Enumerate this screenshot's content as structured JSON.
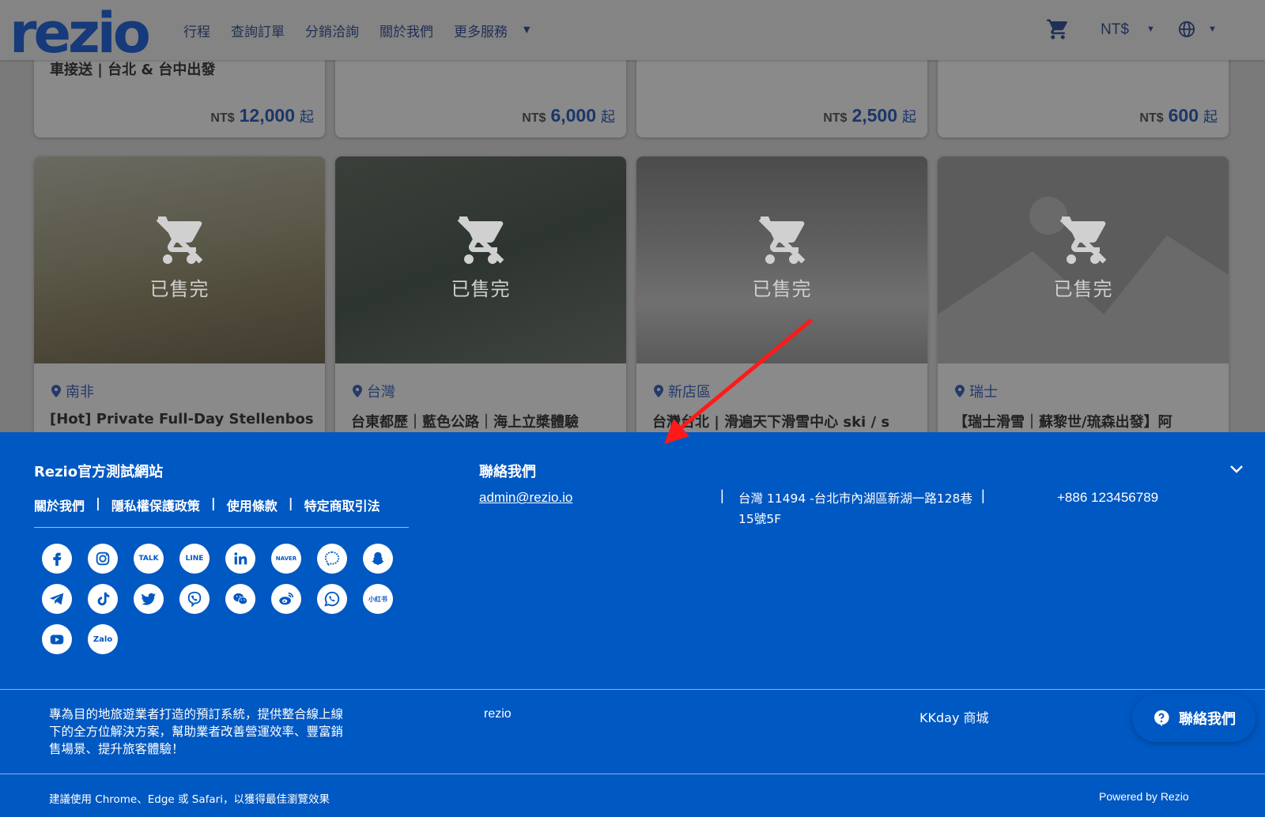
{
  "header": {
    "logo": "rezio",
    "nav": [
      "行程",
      "查詢訂單",
      "分銷洽詢",
      "關於我們",
      "更多服務"
    ],
    "currency": "NT$"
  },
  "top_cards": [
    {
      "title": "車接送 | 台北 & 台中出發",
      "currency": "NT$",
      "price": "12,000",
      "suffix": "起"
    },
    {
      "title": "",
      "currency": "NT$",
      "price": "6,000",
      "suffix": "起"
    },
    {
      "title": "",
      "currency": "NT$",
      "price": "2,500",
      "suffix": "起"
    },
    {
      "title": "",
      "currency": "NT$",
      "price": "600",
      "suffix": "起"
    }
  ],
  "products": [
    {
      "status": "已售完",
      "location": "南非",
      "title": "[Hot] Private Full-Day Stellenbos"
    },
    {
      "status": "已售完",
      "location": "台灣",
      "title": "台東都歷｜藍色公路｜海上立槳體驗"
    },
    {
      "status": "已售完",
      "location": "新店區",
      "title": "台灣台北 | 滑遍天下滑雪中心 ski / s"
    },
    {
      "status": "已售完",
      "location": "瑞士",
      "title": "【瑞士滑雪｜蘇黎世/琉森出發】阿"
    }
  ],
  "footer": {
    "site_name": "Rezio官方測試網站",
    "links": [
      "關於我們",
      "隱私權保護政策",
      "使用條款",
      "特定商取引法"
    ],
    "link_sep": "|",
    "socials": [
      "facebook-icon",
      "instagram-icon",
      "kakaotalk-icon",
      "line-icon",
      "linkedin-icon",
      "naver-icon",
      "messenger-icon",
      "snapchat-icon",
      "telegram-icon",
      "tiktok-icon",
      "twitter-icon",
      "viber-icon",
      "wechat-icon",
      "weibo-icon",
      "whatsapp-icon",
      "xiaohongshu-icon",
      "youtube-icon",
      "zalo-icon"
    ],
    "social_text": {
      "kakaotalk": "TALK",
      "line": "LINE",
      "naver": "NAVER",
      "xiaohongshu": "小红书",
      "zalo": "Zalo"
    },
    "contact_title": "聯絡我們",
    "email": "admin@rezio.io",
    "sep": "|",
    "address": "台灣 11494 -台北市內湖區新湖一路128巷15號5F",
    "phone": "+886 123456789",
    "description": "專為目的地旅遊業者打造的預訂系統，提供整合線上線下的全方位解決方案，幫助業者改善營運效率、豐富銷售場景、提升旅客體驗！",
    "link_rezio": "rezio",
    "link_kkday": "KKday 商城",
    "browser_note": "建議使用 Chrome、Edge 或 Safari，以獲得最佳瀏覽效果",
    "powered_by": "Powered by Rezio"
  },
  "floating_button": {
    "label": "聯絡我們"
  },
  "colors": {
    "footer_bg": "#0058c2",
    "price": "#1b3668",
    "arrow": "#ff1a1a"
  }
}
